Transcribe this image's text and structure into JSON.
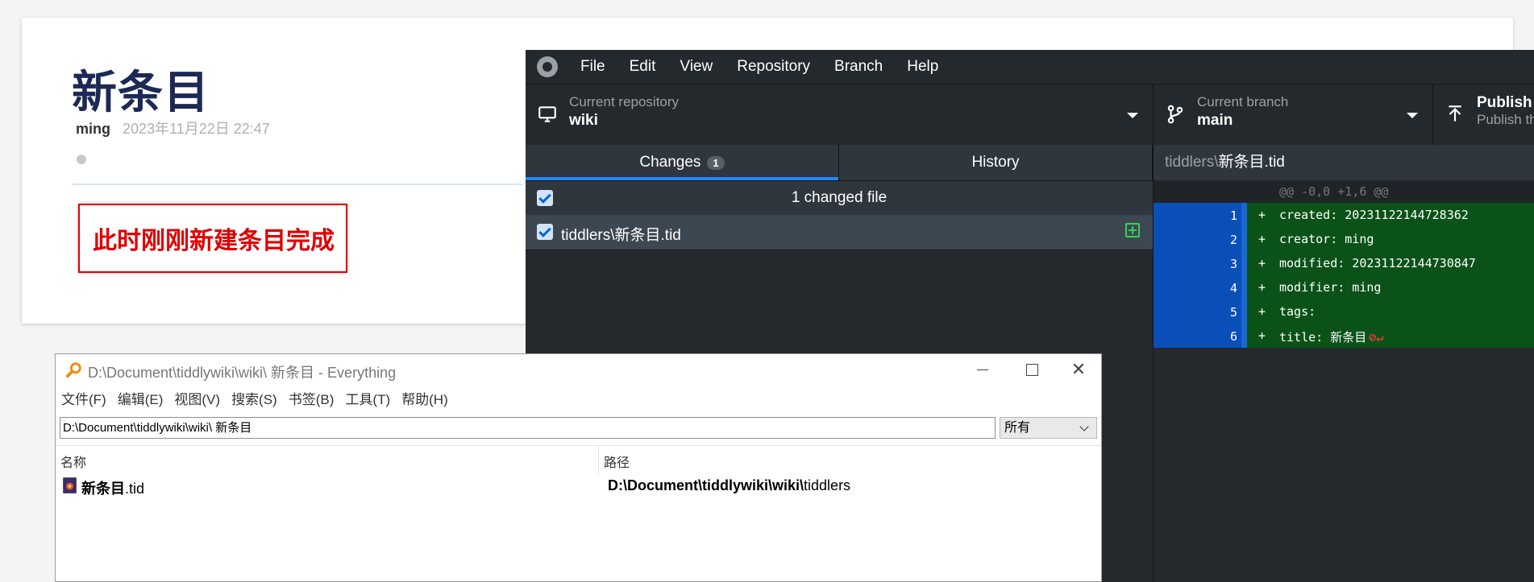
{
  "tiddler": {
    "title": "新条目",
    "author": "ming",
    "date": "2023年11月22日 22:47",
    "callout": "此时刚刚新建条目完成"
  },
  "github_desktop": {
    "menu": [
      "File",
      "Edit",
      "View",
      "Repository",
      "Branch",
      "Help"
    ],
    "repo_label": "Current repository",
    "repo_value": "wiki",
    "branch_label": "Current branch",
    "branch_value": "main",
    "publish_label": "Publish r",
    "publish_sub": "Publish th",
    "tabs": {
      "changes": "Changes",
      "changes_count": "1",
      "history": "History"
    },
    "changed_files_label": "1 changed file",
    "file_name": "tiddlers\\新条目.tid",
    "diff": {
      "path_dir": "tiddlers\\",
      "path_file": "新条目.tid",
      "hunk": "@@ -0,0 +1,6 @@",
      "lines": [
        {
          "n": "1",
          "text": "created: 20231122144728362"
        },
        {
          "n": "2",
          "text": "creator: ming"
        },
        {
          "n": "3",
          "text": "modified: 20231122144730847"
        },
        {
          "n": "4",
          "text": "modifier: ming"
        },
        {
          "n": "5",
          "text": "tags:"
        },
        {
          "n": "6",
          "text": "title: 新条目"
        }
      ]
    }
  },
  "everything": {
    "window_title": "D:\\Document\\tiddlywiki\\wiki\\ 新条目 - Everything",
    "menu": [
      "文件(F)",
      "编辑(E)",
      "视图(V)",
      "搜索(S)",
      "书签(B)",
      "工具(T)",
      "帮助(H)"
    ],
    "search_value": "D:\\Document\\tiddlywiki\\wiki\\ 新条目",
    "filter_value": "所有",
    "col_name": "名称",
    "col_path": "路径",
    "result": {
      "name_bold": "新条目",
      "name_rest": ".tid",
      "path_bold": "D:\\Document\\tiddlywiki\\wiki\\",
      "path_rest": "tiddlers"
    }
  },
  "colors": {
    "wiki_title": "#1b2954",
    "callout_red": "#e00000",
    "gh_bg": "#24292e",
    "diff_added": "#0b5218",
    "diff_gutter": "#0a4fb8",
    "tab_accent": "#2188ff"
  }
}
